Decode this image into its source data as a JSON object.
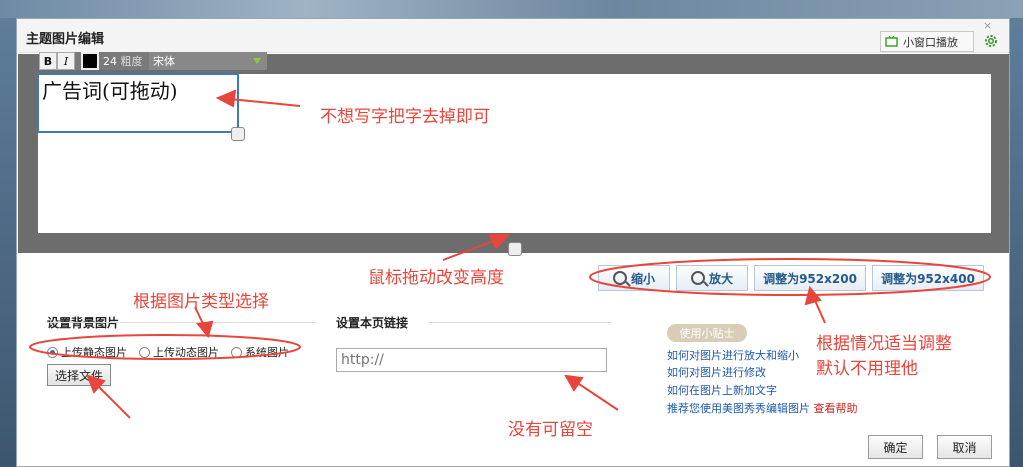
{
  "dialog": {
    "title": "主题图片编辑",
    "mini_window_label": "小窗口播放"
  },
  "editor": {
    "font_size": "24",
    "font_name": "宋体",
    "font_hidden_text": "粗度",
    "bold_label": "B",
    "italic_label": "I",
    "ad_text": "广告词(可拖动)"
  },
  "zoom": {
    "zoom_out": "缩小",
    "zoom_in": "放大",
    "fit_200": "调整为952x200",
    "fit_400": "调整为952x400"
  },
  "background": {
    "section_label": "设置背景图片",
    "options": [
      "上传静态图片",
      "上传动态图片",
      "系统图片"
    ],
    "selected": "上传静态图片",
    "choose_file": "选择文件"
  },
  "link": {
    "section_label": "设置本页链接",
    "placeholder": "http://"
  },
  "tips": {
    "badge": "使用小贴士",
    "items": [
      "如何对图片进行放大和缩小",
      "如何对图片进行修改",
      "如何在图片上新加文字",
      "推荐您使用美图秀秀编辑图片"
    ],
    "help": "查看帮助"
  },
  "footer": {
    "ok": "确定",
    "cancel": "取消"
  },
  "annotations": {
    "remove_text": "不想写字把字去掉即可",
    "drag_height": "鼠标拖动改变高度",
    "choose_type": "根据图片类型选择",
    "adjust": "根据情况适当调整",
    "default": "默认不用理他",
    "optional": "没有可留空"
  },
  "colors": {
    "annotation": "#e8453c",
    "link": "#1e5aa8",
    "help": "#d01f1f"
  }
}
